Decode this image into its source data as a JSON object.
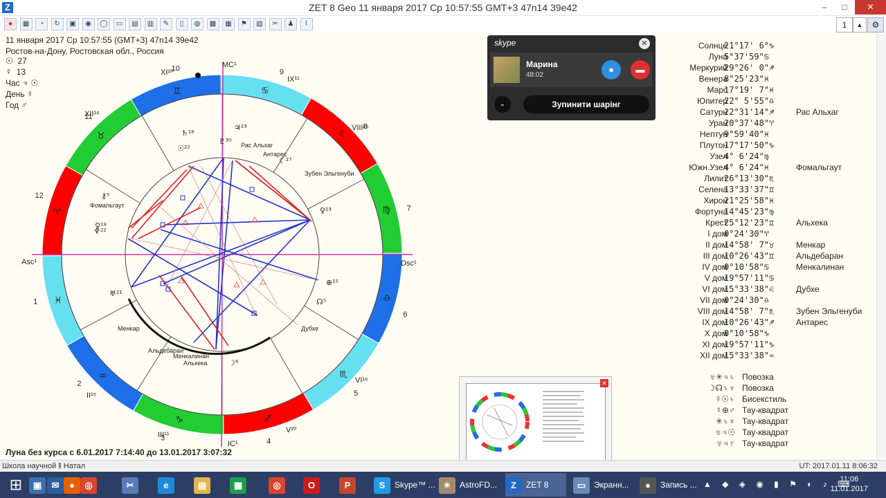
{
  "window": {
    "title": "ZET 8 Geo    11 января 2017  Ср  10:57:55 GMT+3 47n14  39e42",
    "app_logo": "Z",
    "minimize": "–",
    "maximize": "□",
    "close": "✕"
  },
  "toolbar": {
    "buttons": [
      "stop-icon",
      "grid-icon",
      "chart-icon",
      "refresh-icon",
      "layout-icon",
      "eye-icon",
      "ring-icon",
      "window-icon",
      "document-icon",
      "scroll-icon",
      "marker-icon",
      "book-icon",
      "brain-icon",
      "image-icon",
      "calendar-icon",
      "flag-icon",
      "pages-icon",
      "scissors-icon",
      "figure-icon",
      "signal-icon"
    ],
    "page_value": "1"
  },
  "chart_header": {
    "line1": "11 января 2017  Ср  10:57:55 (GMT+3) 47n14  39e42",
    "line2": "Ростов-на-Дону, Ростовская обл., Россия"
  },
  "rulers": [
    {
      "glyph": "☉",
      "value": "27"
    },
    {
      "glyph": "☿",
      "value": "13"
    },
    {
      "label": "Час",
      "glyph": "♃ ☉"
    },
    {
      "label": "День",
      "glyph": "☿"
    },
    {
      "label": "Год",
      "glyph": "♂"
    }
  ],
  "wheel": {
    "angles": {
      "asc": "Asc¹",
      "dsc": "Dsc¹",
      "mc": "MC¹",
      "ic": "IC¹"
    },
    "house_numbers": [
      "1",
      "2",
      "3",
      "4",
      "5",
      "6",
      "7",
      "8",
      "9",
      "10",
      "11",
      "12"
    ],
    "house_roman": [
      "II¹⁵",
      "III¹¹",
      "V²⁰",
      "VI¹⁶",
      "VIII¹⁵",
      "IX¹¹",
      "XI²⁰",
      "XII¹⁶"
    ],
    "signs": [
      "♈",
      "♉",
      "♊",
      "♋",
      "♌",
      "♍",
      "♎",
      "♏",
      "♐",
      "♑",
      "♒",
      "♓"
    ],
    "sign_colors": [
      "#ff0000",
      "#22cc33",
      "#1e6fe8",
      "#66dff0"
    ],
    "star_labels": [
      "Рас Альхаг",
      "Антарес",
      "Зубен Эльгенуби",
      "Фомальгаут",
      "Менкар",
      "Альдебаран",
      "Менкалинан",
      "Альхека",
      "Дубхе"
    ],
    "planet_glyphs": [
      "♄¹⁸",
      "☉²²",
      "♇³⁰",
      "♃²³",
      "☾²⁷",
      "♀²³",
      "⊕¹⁵",
      "☊⁵",
      "♅²¹",
      "☽⁶",
      "⚷⁵",
      "♀¹⁸",
      "♆²²"
    ]
  },
  "moon_free": "Луна без курса с 6.01.2017  7:14:40 до 13.01.2017  3:07:32",
  "statusbar": {
    "left": "Школа научной  ‖ Натал",
    "right": "UT: 2017.01.11  8:06:32"
  },
  "planets": [
    {
      "name": "Солнце",
      "glyph": "☉",
      "deg": "21°17' 6\"♑",
      "star": ""
    },
    {
      "name": "Луна",
      "glyph": "☽",
      "deg": " 5°37'59\"♋",
      "star": ""
    },
    {
      "name": "Меркурий",
      "glyph": "☿",
      "deg": "29°26' 0\"♐",
      "star": ""
    },
    {
      "name": "Венера",
      "glyph": "♀",
      "deg": " 8°25'23\"♓",
      "star": ""
    },
    {
      "name": "Марс",
      "glyph": "♂",
      "deg": "17°19' 7\"♓",
      "star": ""
    },
    {
      "name": "Юпитер",
      "glyph": "♃",
      "deg": "22° 5'55\"♎",
      "star": ""
    },
    {
      "name": "Сатурн",
      "glyph": "♄",
      "deg": "22°31'14\"♐",
      "star": "Рас Альхаг"
    },
    {
      "name": "Уран",
      "glyph": "♅",
      "deg": "20°37'48\"♈",
      "star": ""
    },
    {
      "name": "Нептун",
      "glyph": "♆",
      "deg": " 9°59'40\"♓",
      "star": ""
    },
    {
      "name": "Плутон",
      "glyph": "♇",
      "deg": "17°17'50\"♑",
      "star": ""
    },
    {
      "name": "Узел",
      "glyph": "☊",
      "deg": " 4° 6'24\"♍",
      "star": ""
    },
    {
      "name": "Южн.Узел",
      "glyph": "☋",
      "deg": " 4° 6'24\"♓",
      "star": "Фомальгаут"
    },
    {
      "name": "Лилит",
      "glyph": "⚸",
      "deg": "26°13'30\"♏",
      "star": ""
    },
    {
      "name": "Селена",
      "glyph": "❀",
      "deg": "13°33'37\"♊",
      "star": ""
    },
    {
      "name": "Хирон",
      "glyph": "⚷",
      "deg": "21°25'58\"♓",
      "star": ""
    },
    {
      "name": "Фортуна",
      "glyph": "⊕",
      "deg": "14°45'23\"♍",
      "star": ""
    },
    {
      "name": "Крест",
      "glyph": "✳",
      "deg": "25°12'23\"♊",
      "star": "Альхека"
    },
    {
      "name": "I дом",
      "glyph": "Asc",
      "deg": " 0°24'30\"♈",
      "star": ""
    },
    {
      "name": "II дом",
      "glyph": "2",
      "deg": "14°58' 7\"♉",
      "star": "Менкар"
    },
    {
      "name": "III дом",
      "glyph": "3",
      "deg": "10°26'43\"♊",
      "star": "Альдебаран"
    },
    {
      "name": "IV дом",
      "glyph": "IC",
      "deg": " 0°10'58\"♋",
      "star": "Менкалинан"
    },
    {
      "name": "V дом",
      "glyph": "5",
      "deg": "19°57'11\"♋",
      "star": ""
    },
    {
      "name": "VI дом",
      "glyph": "6",
      "deg": "15°33'38\"♌",
      "star": "Дубхе"
    },
    {
      "name": "VII дом",
      "glyph": "Dsc",
      "deg": " 0°24'30\"♎",
      "star": ""
    },
    {
      "name": "VIII дом",
      "glyph": "8",
      "deg": "14°58' 7\"♏",
      "star": "Зубен Эльгенуби"
    },
    {
      "name": "IX дом",
      "glyph": "9",
      "deg": "10°26'43\"♐",
      "star": "Антарес"
    },
    {
      "name": "X дом",
      "glyph": "MC",
      "deg": " 0°10'58\"♑",
      "star": ""
    },
    {
      "name": "XI дом",
      "glyph": "11",
      "deg": "19°57'11\"♑",
      "star": ""
    },
    {
      "name": "XII дом",
      "glyph": "12",
      "deg": "15°33'38\"♒",
      "star": ""
    }
  ],
  "aspects": [
    {
      "glyphs": "♅✳♃♄",
      "label": "Повозка"
    },
    {
      "glyphs": "☽☊♄♆",
      "label": "Повозка"
    },
    {
      "glyphs": "☿☉♄",
      "label": "Бисекстиль"
    },
    {
      "glyphs": "☿⊕♂",
      "label": "Тау-квадрат"
    },
    {
      "glyphs": "✳♄♆",
      "label": "Тау-квадрат"
    },
    {
      "glyphs": "♅♃☉",
      "label": "Тау-квадрат"
    },
    {
      "glyphs": "♅♃♇",
      "label": "Тау-квадрат"
    }
  ],
  "skype": {
    "logo": "skype",
    "close": "✕",
    "contact": "Марина",
    "duration": "48:02",
    "mic": "🎙",
    "hangup": "☎",
    "chevron": "⌄",
    "stop_sharing": "Зупинити шарінг"
  },
  "taskbar": {
    "start": "⊞",
    "items": [
      {
        "label": "",
        "icon": "monitor-icon",
        "color": "#3a6fb0",
        "glyph": "▣"
      },
      {
        "label": "",
        "icon": "mail-icon",
        "color": "#2b5fa0",
        "glyph": "✉"
      },
      {
        "label": "",
        "icon": "firefox-icon",
        "color": "#e66000",
        "glyph": "●"
      },
      {
        "label": "",
        "icon": "chrome-icon",
        "color": "#d9442f",
        "glyph": "◎"
      },
      {
        "label": "",
        "icon": "snipping-icon",
        "color": "#5a7ab8",
        "glyph": "✂"
      },
      {
        "label": "",
        "icon": "ie-icon",
        "color": "#1f8ad8",
        "glyph": "e"
      },
      {
        "label": "",
        "icon": "folder-icon",
        "color": "#e0b84a",
        "glyph": "▤"
      },
      {
        "label": "",
        "icon": "store-icon",
        "color": "#1d9e4b",
        "glyph": "▦"
      },
      {
        "label": "",
        "icon": "chrome-icon-2",
        "color": "#d9442f",
        "glyph": "◎"
      },
      {
        "label": "",
        "icon": "opera-icon",
        "color": "#cc1b1b",
        "glyph": "O"
      },
      {
        "label": "",
        "icon": "powerpoint-icon",
        "color": "#c8462b",
        "glyph": "P"
      },
      {
        "label": "Skype™ ...",
        "icon": "skype-icon",
        "color": "#1f9be3",
        "glyph": "S"
      },
      {
        "label": "AstroFD...",
        "icon": "astro-icon",
        "color": "#a38a6a",
        "glyph": "✴"
      },
      {
        "label": "ZET 8",
        "icon": "zet-icon",
        "color": "#2468c8",
        "glyph": "Z"
      },
      {
        "label": "Экранн...",
        "icon": "screen-icon",
        "color": "#6a8ab8",
        "glyph": "▭"
      },
      {
        "label": "Запись ...",
        "icon": "record-icon",
        "color": "#555",
        "glyph": "●"
      }
    ],
    "time": "11:06",
    "date": "11.01.2017"
  }
}
